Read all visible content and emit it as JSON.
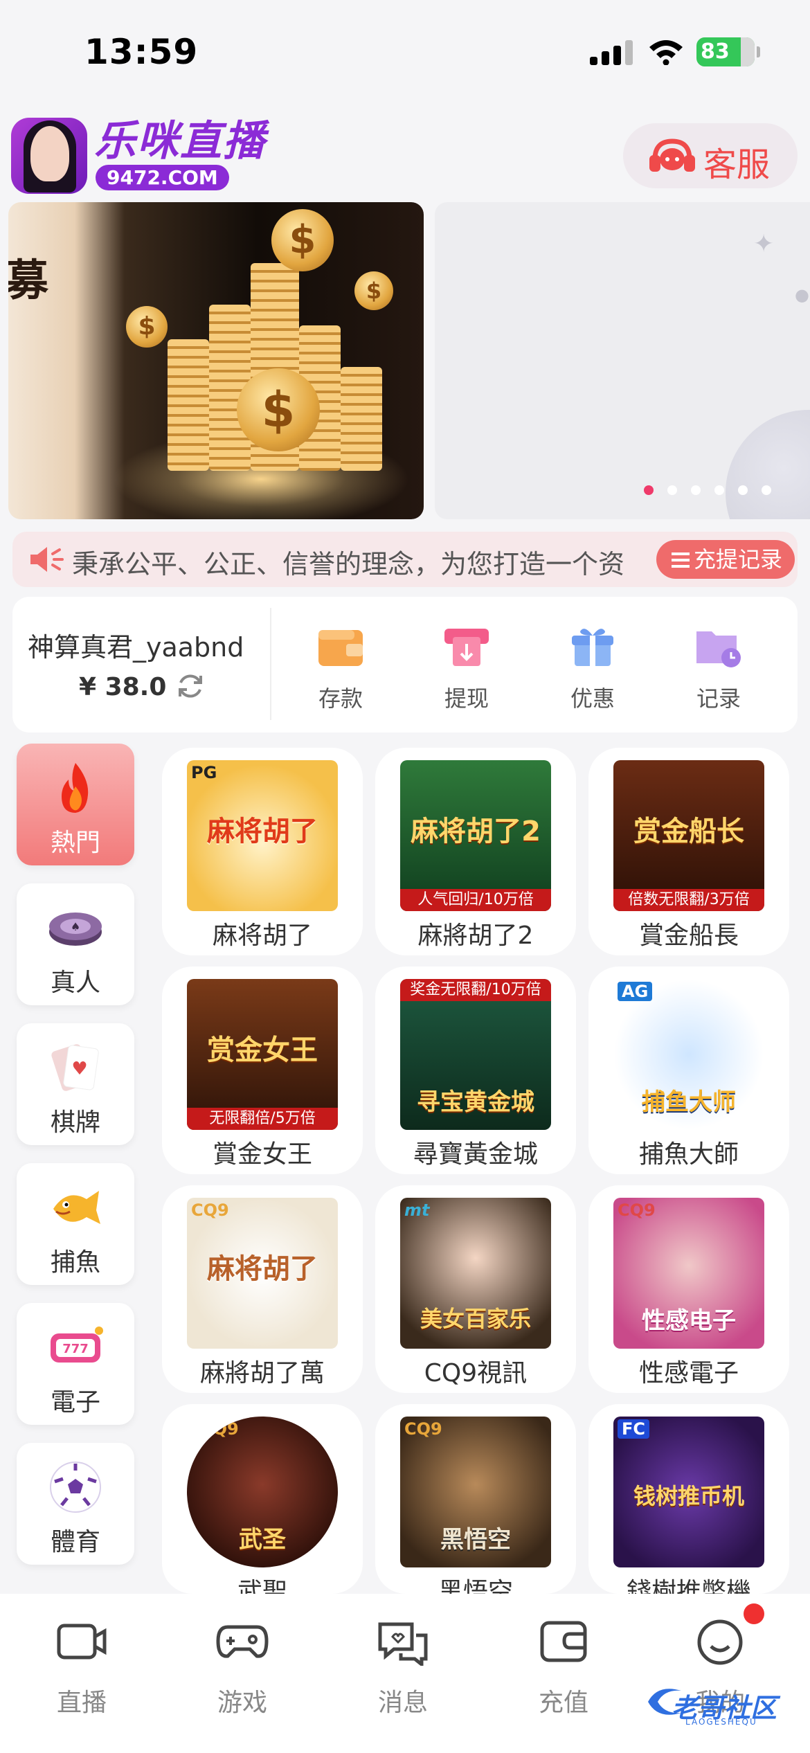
{
  "status_bar": {
    "time": "13:59",
    "battery": "83"
  },
  "header": {
    "brand_name": "乐咪直播",
    "brand_domain": "9472.COM",
    "customer_service": "客服"
  },
  "banner": {
    "slide1_char": "募",
    "slide_count": 6,
    "active_slide": 1
  },
  "notice": {
    "text": "秉承公平、公正、信誉的理念，为您打造一个资",
    "records_button": "充提记录"
  },
  "wallet": {
    "username": "神算真君_yaabnd",
    "balance": "¥ 38.0",
    "actions": [
      {
        "label": "存款",
        "icon": "wallet-icon"
      },
      {
        "label": "提现",
        "icon": "withdraw-icon"
      },
      {
        "label": "优惠",
        "icon": "gift-icon"
      },
      {
        "label": "记录",
        "icon": "folder-clock-icon"
      }
    ]
  },
  "categories": [
    {
      "label": "熱門",
      "icon": "flame-icon",
      "active": true
    },
    {
      "label": "真人",
      "icon": "poker-chip-icon"
    },
    {
      "label": "棋牌",
      "icon": "playing-card-icon"
    },
    {
      "label": "捕魚",
      "icon": "fish-icon"
    },
    {
      "label": "電子",
      "icon": "slot-machine-icon"
    },
    {
      "label": "體育",
      "icon": "soccer-ball-icon"
    }
  ],
  "games": [
    {
      "name": "麻将胡了",
      "provider": "PG",
      "thumb_text": "麻将胡了",
      "tag": ""
    },
    {
      "name": "麻將胡了2",
      "provider": "",
      "thumb_text": "麻将胡了2",
      "tag": "人气回归/10万倍"
    },
    {
      "name": "賞金船長",
      "provider": "",
      "thumb_text": "赏金船长",
      "tag": "倍数无限翻/3万倍"
    },
    {
      "name": "賞金女王",
      "provider": "",
      "thumb_text": "赏金女王",
      "tag": "无限翻倍/5万倍"
    },
    {
      "name": "尋寶黃金城",
      "provider": "",
      "thumb_text": "寻宝黄金城",
      "tag": "奖金无限翻/10万倍"
    },
    {
      "name": "捕魚大師",
      "provider": "AG",
      "thumb_text": "捕鱼大师",
      "tag": ""
    },
    {
      "name": "麻將胡了萬",
      "provider": "CQ9",
      "thumb_text": "麻将胡了",
      "tag": ""
    },
    {
      "name": "CQ9視訊",
      "provider": "mt",
      "thumb_text": "美女百家乐",
      "tag": ""
    },
    {
      "name": "性感電子",
      "provider": "CQ9",
      "thumb_text": "性感电子",
      "tag": ""
    },
    {
      "name": "武聖",
      "provider": "CQ9",
      "thumb_text": "武圣",
      "tag": ""
    },
    {
      "name": "黑悟空",
      "provider": "CQ9",
      "thumb_text": "黑悟空",
      "tag": ""
    },
    {
      "name": "錢樹推幣機",
      "provider": "FC",
      "thumb_text": "钱树推币机",
      "tag": ""
    }
  ],
  "tabbar": [
    {
      "label": "直播",
      "icon": "camera-icon"
    },
    {
      "label": "游戏",
      "icon": "gamepad-icon"
    },
    {
      "label": "消息",
      "icon": "chat-icon"
    },
    {
      "label": "充值",
      "icon": "wallet-icon"
    },
    {
      "label": "我的",
      "icon": "smile-icon"
    }
  ],
  "watermark": {
    "text": "老哥社区",
    "sub": "LAOGESHEQU"
  },
  "colors": {
    "accent": "#ef3a6a",
    "brand": "#8b2bd6",
    "hot": "#f27a7a"
  }
}
